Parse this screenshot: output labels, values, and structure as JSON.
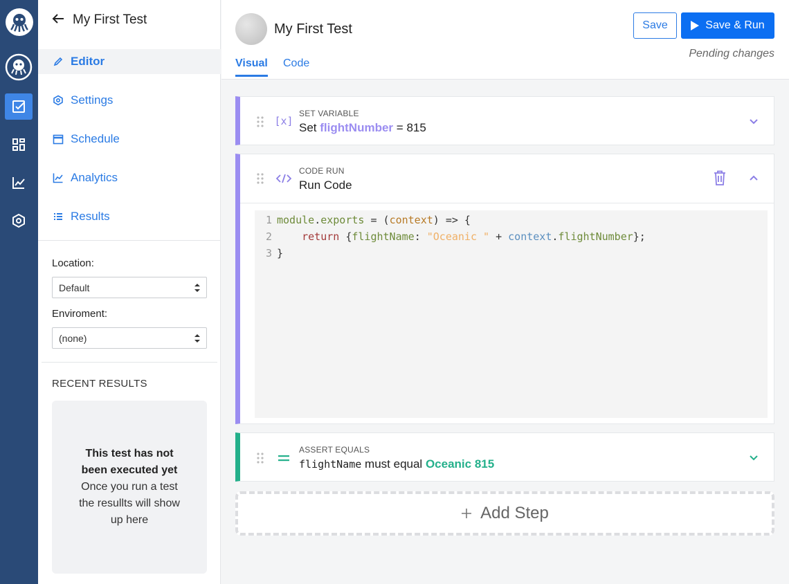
{
  "sidebar": {
    "back_title": "My First Test",
    "nav": [
      {
        "label": "Editor",
        "icon": "pencil-icon"
      },
      {
        "label": "Settings",
        "icon": "gear-icon"
      },
      {
        "label": "Schedule",
        "icon": "calendar-icon"
      },
      {
        "label": "Analytics",
        "icon": "chart-icon"
      },
      {
        "label": "Results",
        "icon": "list-icon"
      }
    ],
    "location_label": "Location:",
    "location_value": "Default",
    "environment_label": "Enviroment:",
    "environment_value": "(none)",
    "recent_title": "RECENT RESULTS",
    "recent_empty_title": "This test has not been executed yet",
    "recent_empty_body": "Once you run a test the resullts will show up here"
  },
  "header": {
    "test_title": "My First Test",
    "save_label": "Save",
    "save_run_label": "Save & Run",
    "pending": "Pending changes",
    "tabs": [
      {
        "label": "Visual",
        "active": true
      },
      {
        "label": "Code",
        "active": false
      }
    ]
  },
  "steps": [
    {
      "kind": "SET VARIABLE",
      "prefix": "Set",
      "variable": "flightNumber",
      "op": "=",
      "value": "815",
      "accent": "#9b8df1"
    },
    {
      "kind": "CODE RUN",
      "title": "Run Code",
      "accent": "#9b8df1",
      "code": {
        "l1": {
          "n": "1",
          "a": "module",
          "b": ".",
          "c": "exports",
          "d": " = (",
          "e": "context",
          "f": ") => {"
        },
        "l2": {
          "n": "2",
          "a": "    ",
          "b": "return",
          "c": " {",
          "d": "flightName",
          "e": ": ",
          "f": "\"Oceanic \"",
          "g": " + ",
          "h": "context",
          "i": ".",
          "j": "flightNumber",
          "k": "};"
        },
        "l3": {
          "n": "3",
          "a": "}"
        }
      }
    },
    {
      "kind": "ASSERT EQUALS",
      "subject": "flightName",
      "verb": "must equal",
      "expected": "Oceanic 815",
      "accent": "#24b08b"
    }
  ],
  "add_step_label": "Add Step"
}
